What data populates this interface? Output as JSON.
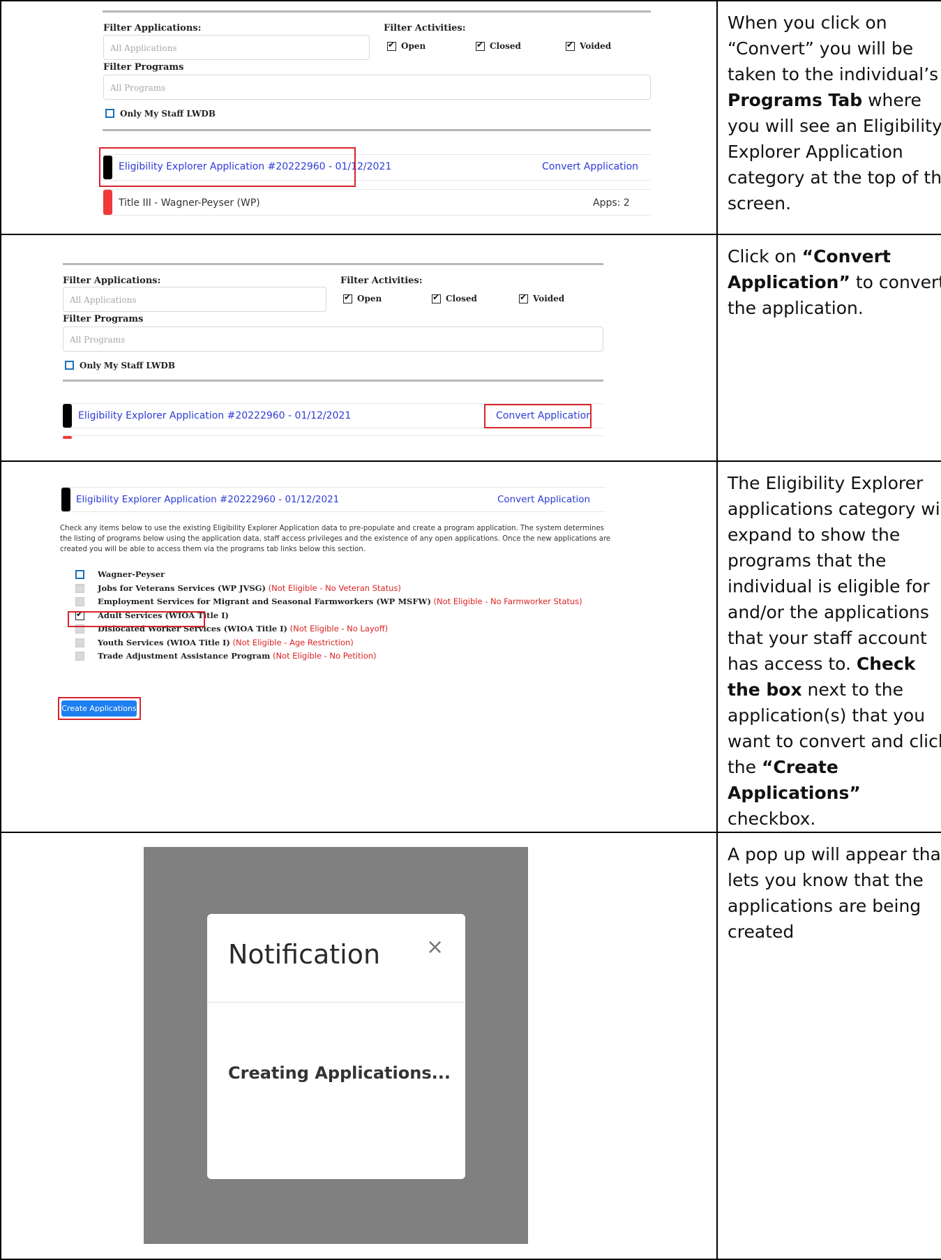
{
  "rows": [
    {
      "description_html": "When you click on “Convert” you will be taken to the individual’s <b>Programs Tab</b> where you will see an Eligibility Explorer Application category at the top of the screen."
    },
    {
      "description_html": "Click on <b>“Convert Application”</b> to convert the application."
    },
    {
      "description_html": "The Eligibility Explorer applications category will expand to show the programs that the individual is eligible for and/or the applications that your staff account has access to. <b>Check the box</b> next to the application(s) that you want to convert and click the <b>“Create Applications”</b> checkbox."
    },
    {
      "description_html": "A pop up will appear that lets you know that the applications are being created"
    }
  ],
  "filters": {
    "filter_applications_label": "Filter Applications:",
    "filter_applications_placeholder": "All Applications",
    "filter_activities_label": "Filter Activities:",
    "open_label": "Open",
    "closed_label": "Closed",
    "voided_label": "Voided",
    "filter_programs_label": "Filter Programs",
    "filter_programs_placeholder": "All Programs",
    "only_my_staff_label": "Only My Staff LWDB"
  },
  "application": {
    "title": "Eligibility Explorer Application #20222960 - 01/12/2021",
    "convert_label": "Convert Application"
  },
  "program_row": {
    "title": "Title III - Wagner-Peyser (WP)",
    "apps": "Apps: 2"
  },
  "expanded": {
    "instructions": "Check any items below to use the existing Eligibility Explorer Application data to pre-populate and create a program application. The system determines the listing of programs below using the application data, staff access privileges and the existence of any open applications. Once the new applications are created you will be able to access them via the programs tab links below this section.",
    "programs": [
      {
        "name": "Wagner-Peyser",
        "note": "",
        "state": "blue"
      },
      {
        "name": "Jobs for Veterans Services (WP JVSG)",
        "note": "(Not Eligible - No Veteran Status)",
        "state": "grey"
      },
      {
        "name": "Employment Services for Migrant and Seasonal Farmworkers (WP MSFW)",
        "note": "(Not Eligible - No Farmworker Status)",
        "state": "grey"
      },
      {
        "name": "Adult Services (WIOA Title I)",
        "note": "",
        "state": "checked"
      },
      {
        "name": "Dislocated Worker Services (WIOA Title I)",
        "note": "(Not Eligible - No Layoff)",
        "state": "grey"
      },
      {
        "name": "Youth Services (WIOA Title I)",
        "note": "(Not Eligible - Age Restriction)",
        "state": "grey"
      },
      {
        "name": "Trade Adjustment Assistance Program",
        "note": "(Not Eligible - No Petition)",
        "state": "grey"
      }
    ],
    "create_button": "Create Applications"
  },
  "notification": {
    "title": "Notification",
    "close_glyph": "×",
    "message": "Creating Applications..."
  },
  "colors": {
    "link_blue": "#2b3bd6",
    "highlight_red": "#d8242a",
    "category_black": "#000000",
    "category_red": "#f0393a",
    "button_blue": "#1e7ff0",
    "overlay_grey": "#808080"
  }
}
